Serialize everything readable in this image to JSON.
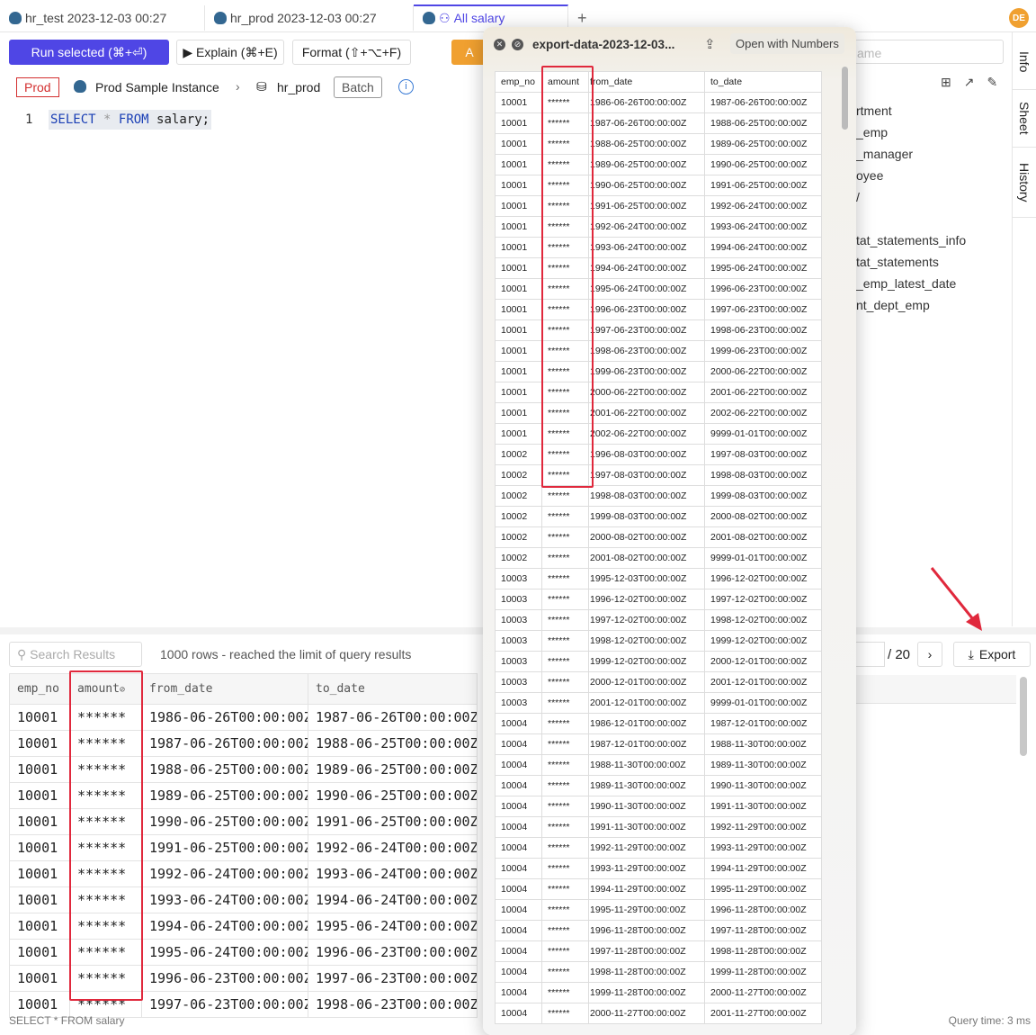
{
  "tabs": [
    {
      "label": "hr_test 2023-12-03 00:27"
    },
    {
      "label": "hr_prod 2023-12-03 00:27"
    },
    {
      "label": "All salary"
    }
  ],
  "new_tab": "+",
  "avatar": "DE",
  "toolbar": {
    "run": "Run selected (⌘+⏎)",
    "explain": "▶ Explain (⌘+E)",
    "format": "Format (⇧+⌥+F)",
    "admin": "A"
  },
  "context": {
    "env": "Prod",
    "instance": "Prod Sample Instance",
    "database": "hr_prod",
    "batch": "Batch"
  },
  "editor": {
    "line": "1",
    "kw1": "SELECT",
    "star": "*",
    "kw2": "FROM",
    "rest": "salary;"
  },
  "colors": {
    "accent": "#4f46e5",
    "prod": "#d32f2f",
    "admin": "#f0a030",
    "highlight": "#e0283c"
  },
  "columns": [
    "emp_no",
    "amount",
    "from_date",
    "to_date"
  ],
  "masked": "******",
  "rows": [
    [
      "10001",
      "1986-06-26T00:00:00Z",
      "1987-06-26T00:00:00Z"
    ],
    [
      "10001",
      "1987-06-26T00:00:00Z",
      "1988-06-25T00:00:00Z"
    ],
    [
      "10001",
      "1988-06-25T00:00:00Z",
      "1989-06-25T00:00:00Z"
    ],
    [
      "10001",
      "1989-06-25T00:00:00Z",
      "1990-06-25T00:00:00Z"
    ],
    [
      "10001",
      "1990-06-25T00:00:00Z",
      "1991-06-25T00:00:00Z"
    ],
    [
      "10001",
      "1991-06-25T00:00:00Z",
      "1992-06-24T00:00:00Z"
    ],
    [
      "10001",
      "1992-06-24T00:00:00Z",
      "1993-06-24T00:00:00Z"
    ],
    [
      "10001",
      "1993-06-24T00:00:00Z",
      "1994-06-24T00:00:00Z"
    ],
    [
      "10001",
      "1994-06-24T00:00:00Z",
      "1995-06-24T00:00:00Z"
    ],
    [
      "10001",
      "1995-06-24T00:00:00Z",
      "1996-06-23T00:00:00Z"
    ],
    [
      "10001",
      "1996-06-23T00:00:00Z",
      "1997-06-23T00:00:00Z"
    ],
    [
      "10001",
      "1997-06-23T00:00:00Z",
      "1998-06-23T00:00:00Z"
    ],
    [
      "10001",
      "1998-06-23T00:00:00Z",
      "1999-06-23T00:00:00Z"
    ],
    [
      "10001",
      "1999-06-23T00:00:00Z",
      "2000-06-22T00:00:00Z"
    ],
    [
      "10001",
      "2000-06-22T00:00:00Z",
      "2001-06-22T00:00:00Z"
    ],
    [
      "10001",
      "2001-06-22T00:00:00Z",
      "2002-06-22T00:00:00Z"
    ],
    [
      "10001",
      "2002-06-22T00:00:00Z",
      "9999-01-01T00:00:00Z"
    ],
    [
      "10002",
      "1996-08-03T00:00:00Z",
      "1997-08-03T00:00:00Z"
    ],
    [
      "10002",
      "1997-08-03T00:00:00Z",
      "1998-08-03T00:00:00Z"
    ],
    [
      "10002",
      "1998-08-03T00:00:00Z",
      "1999-08-03T00:00:00Z"
    ],
    [
      "10002",
      "1999-08-03T00:00:00Z",
      "2000-08-02T00:00:00Z"
    ],
    [
      "10002",
      "2000-08-02T00:00:00Z",
      "2001-08-02T00:00:00Z"
    ],
    [
      "10002",
      "2001-08-02T00:00:00Z",
      "9999-01-01T00:00:00Z"
    ],
    [
      "10003",
      "1995-12-03T00:00:00Z",
      "1996-12-02T00:00:00Z"
    ],
    [
      "10003",
      "1996-12-02T00:00:00Z",
      "1997-12-02T00:00:00Z"
    ],
    [
      "10003",
      "1997-12-02T00:00:00Z",
      "1998-12-02T00:00:00Z"
    ],
    [
      "10003",
      "1998-12-02T00:00:00Z",
      "1999-12-02T00:00:00Z"
    ],
    [
      "10003",
      "1999-12-02T00:00:00Z",
      "2000-12-01T00:00:00Z"
    ],
    [
      "10003",
      "2000-12-01T00:00:00Z",
      "2001-12-01T00:00:00Z"
    ],
    [
      "10003",
      "2001-12-01T00:00:00Z",
      "9999-01-01T00:00:00Z"
    ],
    [
      "10004",
      "1986-12-01T00:00:00Z",
      "1987-12-01T00:00:00Z"
    ],
    [
      "10004",
      "1987-12-01T00:00:00Z",
      "1988-11-30T00:00:00Z"
    ],
    [
      "10004",
      "1988-11-30T00:00:00Z",
      "1989-11-30T00:00:00Z"
    ],
    [
      "10004",
      "1989-11-30T00:00:00Z",
      "1990-11-30T00:00:00Z"
    ],
    [
      "10004",
      "1990-11-30T00:00:00Z",
      "1991-11-30T00:00:00Z"
    ],
    [
      "10004",
      "1991-11-30T00:00:00Z",
      "1992-11-29T00:00:00Z"
    ],
    [
      "10004",
      "1992-11-29T00:00:00Z",
      "1993-11-29T00:00:00Z"
    ],
    [
      "10004",
      "1993-11-29T00:00:00Z",
      "1994-11-29T00:00:00Z"
    ],
    [
      "10004",
      "1994-11-29T00:00:00Z",
      "1995-11-29T00:00:00Z"
    ],
    [
      "10004",
      "1995-11-29T00:00:00Z",
      "1996-11-28T00:00:00Z"
    ],
    [
      "10004",
      "1996-11-28T00:00:00Z",
      "1997-11-28T00:00:00Z"
    ],
    [
      "10004",
      "1997-11-28T00:00:00Z",
      "1998-11-28T00:00:00Z"
    ],
    [
      "10004",
      "1998-11-28T00:00:00Z",
      "1999-11-28T00:00:00Z"
    ],
    [
      "10004",
      "1999-11-28T00:00:00Z",
      "2000-11-27T00:00:00Z"
    ],
    [
      "10004",
      "2000-11-27T00:00:00Z",
      "2001-11-27T00:00:00Z"
    ]
  ],
  "preview": {
    "title": "export-data-2023-12-03...",
    "open_with": "Open with Numbers"
  },
  "results": {
    "search_placeholder": "Search Results",
    "summary": "1000 rows  -  reached the limit of query results",
    "page_total": "/ 20",
    "next": "›",
    "export": "Export",
    "statement": "SELECT * FROM salary",
    "query_time": "Query time: 3 ms"
  },
  "sidebar": {
    "search_placeholder": "ame",
    "items": [
      "rtment",
      "_emp",
      "_manager",
      "oyee",
      "/",
      "tat_statements_info",
      "tat_statements",
      "_emp_latest_date",
      "nt_dept_emp"
    ]
  },
  "side_tabs": [
    "Info",
    "Sheet",
    "History"
  ]
}
